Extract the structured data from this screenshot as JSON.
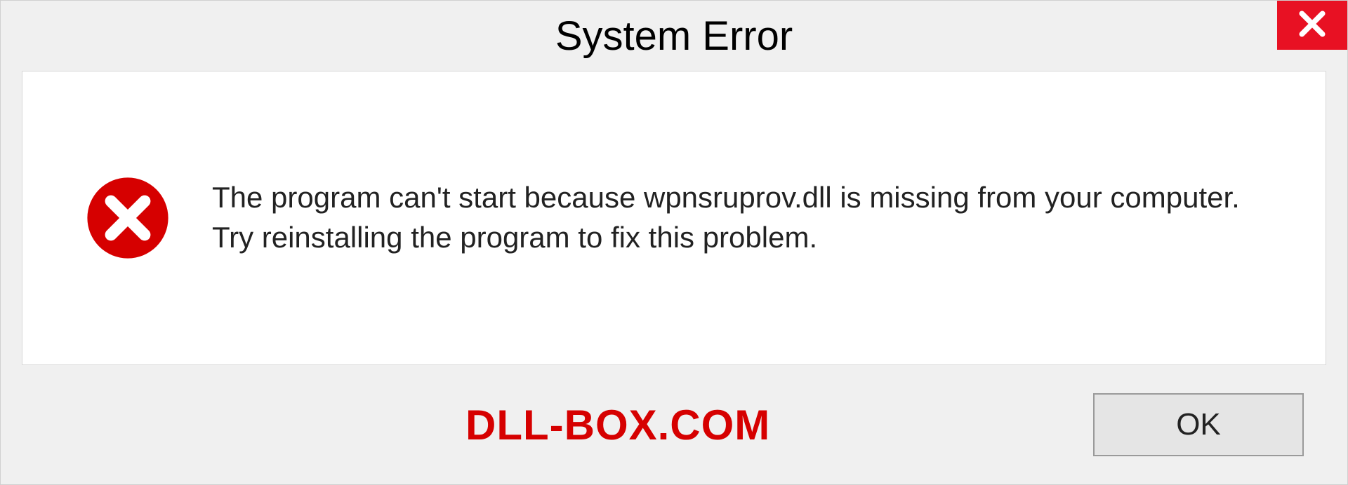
{
  "titlebar": {
    "title": "System Error",
    "close_icon_name": "close-icon"
  },
  "body": {
    "error_icon_name": "error-icon",
    "message": "The program can't start because wpnsruprov.dll is missing from your computer. Try reinstalling the program to fix this problem."
  },
  "footer": {
    "watermark": "DLL-BOX.COM",
    "ok_button_label": "OK"
  },
  "colors": {
    "close_bg": "#e81123",
    "error_icon": "#d60000",
    "watermark": "#d60000"
  }
}
